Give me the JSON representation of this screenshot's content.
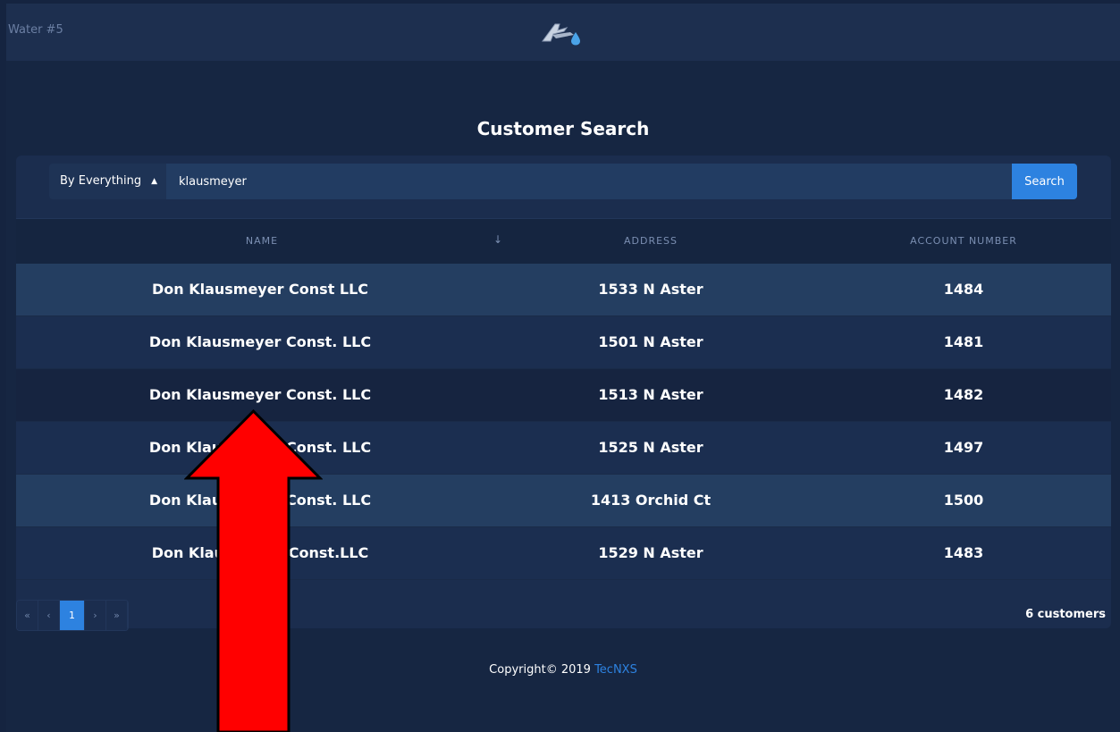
{
  "app": {
    "title": "Water #5"
  },
  "page": {
    "title": "Customer Search"
  },
  "search": {
    "filter_value": "By Everything",
    "query": "klausmeyer",
    "button_label": "Search"
  },
  "table": {
    "columns": [
      "NAME",
      "ADDRESS",
      "ACCOUNT NUMBER"
    ],
    "sort_icon": "↓",
    "rows": [
      {
        "name": "Don Klausmeyer Const LLC",
        "address": "1533 N Aster",
        "account": "1484"
      },
      {
        "name": "Don Klausmeyer Const. LLC",
        "address": "1501 N Aster",
        "account": "1481"
      },
      {
        "name": "Don Klausmeyer Const. LLC",
        "address": "1513 N Aster",
        "account": "1482"
      },
      {
        "name": "Don Klausmeyer Const. LLC",
        "address": "1525 N Aster",
        "account": "1497"
      },
      {
        "name": "Don Klausmeyer Const. LLC",
        "address": "1413 Orchid Ct",
        "account": "1500"
      },
      {
        "name": "Don Klausmeyer Const.LLC",
        "address": "1529 N Aster",
        "account": "1483"
      }
    ]
  },
  "pagination": {
    "first": "«",
    "prev": "‹",
    "current": "1",
    "next": "›",
    "last": "»"
  },
  "result_count": "6 customers",
  "footer": {
    "copyright": "Copyright© 2019",
    "company": "TecNXS"
  },
  "colors": {
    "accent": "#2d82e0",
    "background": "#152440",
    "annotation_arrow": "#ff0000"
  }
}
